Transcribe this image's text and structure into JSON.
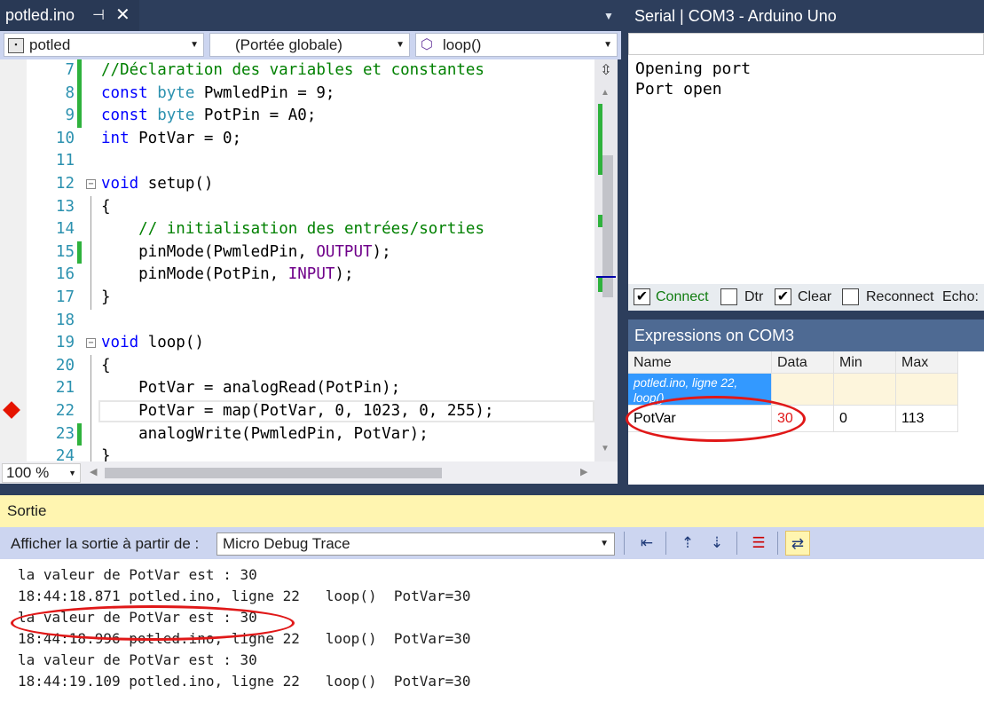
{
  "editor": {
    "tab_title": "potled.ino",
    "pin_glyph": "∈",
    "close_glyph": "✕",
    "nav": {
      "project": "potled",
      "scope": "(Portée globale)",
      "member": "loop()"
    },
    "zoom": "100 %",
    "lines": [
      {
        "num": "7",
        "html": "<span class='c'>//Déclaration des variables et constantes</span>",
        "changed": true
      },
      {
        "num": "8",
        "html": "<span class='k'>const</span> <span class='t'>byte</span> PwmledPin = 9;",
        "changed": true
      },
      {
        "num": "9",
        "html": "<span class='k'>const</span> <span class='t'>byte</span> PotPin = A0;",
        "changed": true
      },
      {
        "num": "10",
        "html": "<span class='k'>int</span> PotVar = 0;",
        "changed": false
      },
      {
        "num": "11",
        "html": "",
        "changed": false
      },
      {
        "num": "12",
        "html": "<span class='k'>void</span> setup()",
        "changed": false,
        "fold": true
      },
      {
        "num": "13",
        "html": "{",
        "changed": false
      },
      {
        "num": "14",
        "html": "    <span class='c'>// initialisation des entrées/sorties</span>",
        "changed": false
      },
      {
        "num": "15",
        "html": "    pinMode(PwmledPin, <span class='p'>OUTPUT</span>);",
        "changed": true
      },
      {
        "num": "16",
        "html": "    pinMode(PotPin, <span class='p'>INPUT</span>);",
        "changed": false
      },
      {
        "num": "17",
        "html": "}",
        "changed": false
      },
      {
        "num": "18",
        "html": "",
        "changed": false
      },
      {
        "num": "19",
        "html": "<span class='k'>void</span> loop()",
        "changed": false,
        "fold": true
      },
      {
        "num": "20",
        "html": "{",
        "changed": false
      },
      {
        "num": "21",
        "html": "    PotVar = analogRead(PotPin);",
        "changed": false
      },
      {
        "num": "22",
        "html": "    PotVar = map(PotVar, 0, 1023, 0, 255);",
        "changed": false
      },
      {
        "num": "23",
        "html": "    analogWrite(PwmledPin, PotVar);",
        "changed": true
      },
      {
        "num": "24",
        "html": "}",
        "changed": false
      }
    ]
  },
  "serial": {
    "title": "Serial | COM3   - Arduino Uno",
    "output": "Opening port\nPort open",
    "controls": {
      "connect": "Connect",
      "connect_checked": true,
      "dtr": "Dtr",
      "dtr_checked": false,
      "clear": "Clear",
      "clear_checked": true,
      "reconnect": "Reconnect",
      "reconnect_checked": false,
      "echo": "Echo:"
    }
  },
  "expressions": {
    "title": "Expressions on COM3",
    "headers": [
      "Name",
      "Data",
      "Min",
      "Max"
    ],
    "context": "potled.ino, ligne 22, loop()",
    "row": {
      "name": "PotVar",
      "data": "30",
      "min": "0",
      "max": "113"
    }
  },
  "output": {
    "title": "Sortie",
    "show_from_label": "Afficher la sortie à partir de :",
    "source": "Micro Debug Trace",
    "lines": [
      "la valeur de PotVar est : 30",
      "18:44:18.871 potled.ino, ligne 22   loop()  PotVar=30",
      "la valeur de PotVar est : 30",
      "18:44:18.996 potled.ino, ligne 22   loop()  PotVar=30",
      "la valeur de PotVar est : 30",
      "18:44:19.109 potled.ino, ligne 22   loop()  PotVar=30"
    ]
  },
  "colors": {
    "accent_dark": "#2d3e5c",
    "panel_title_active": "#4e6a93",
    "highlight_red": "#e01818",
    "output_title_bg": "#fff5b0",
    "change_marker": "#2fb23d"
  }
}
